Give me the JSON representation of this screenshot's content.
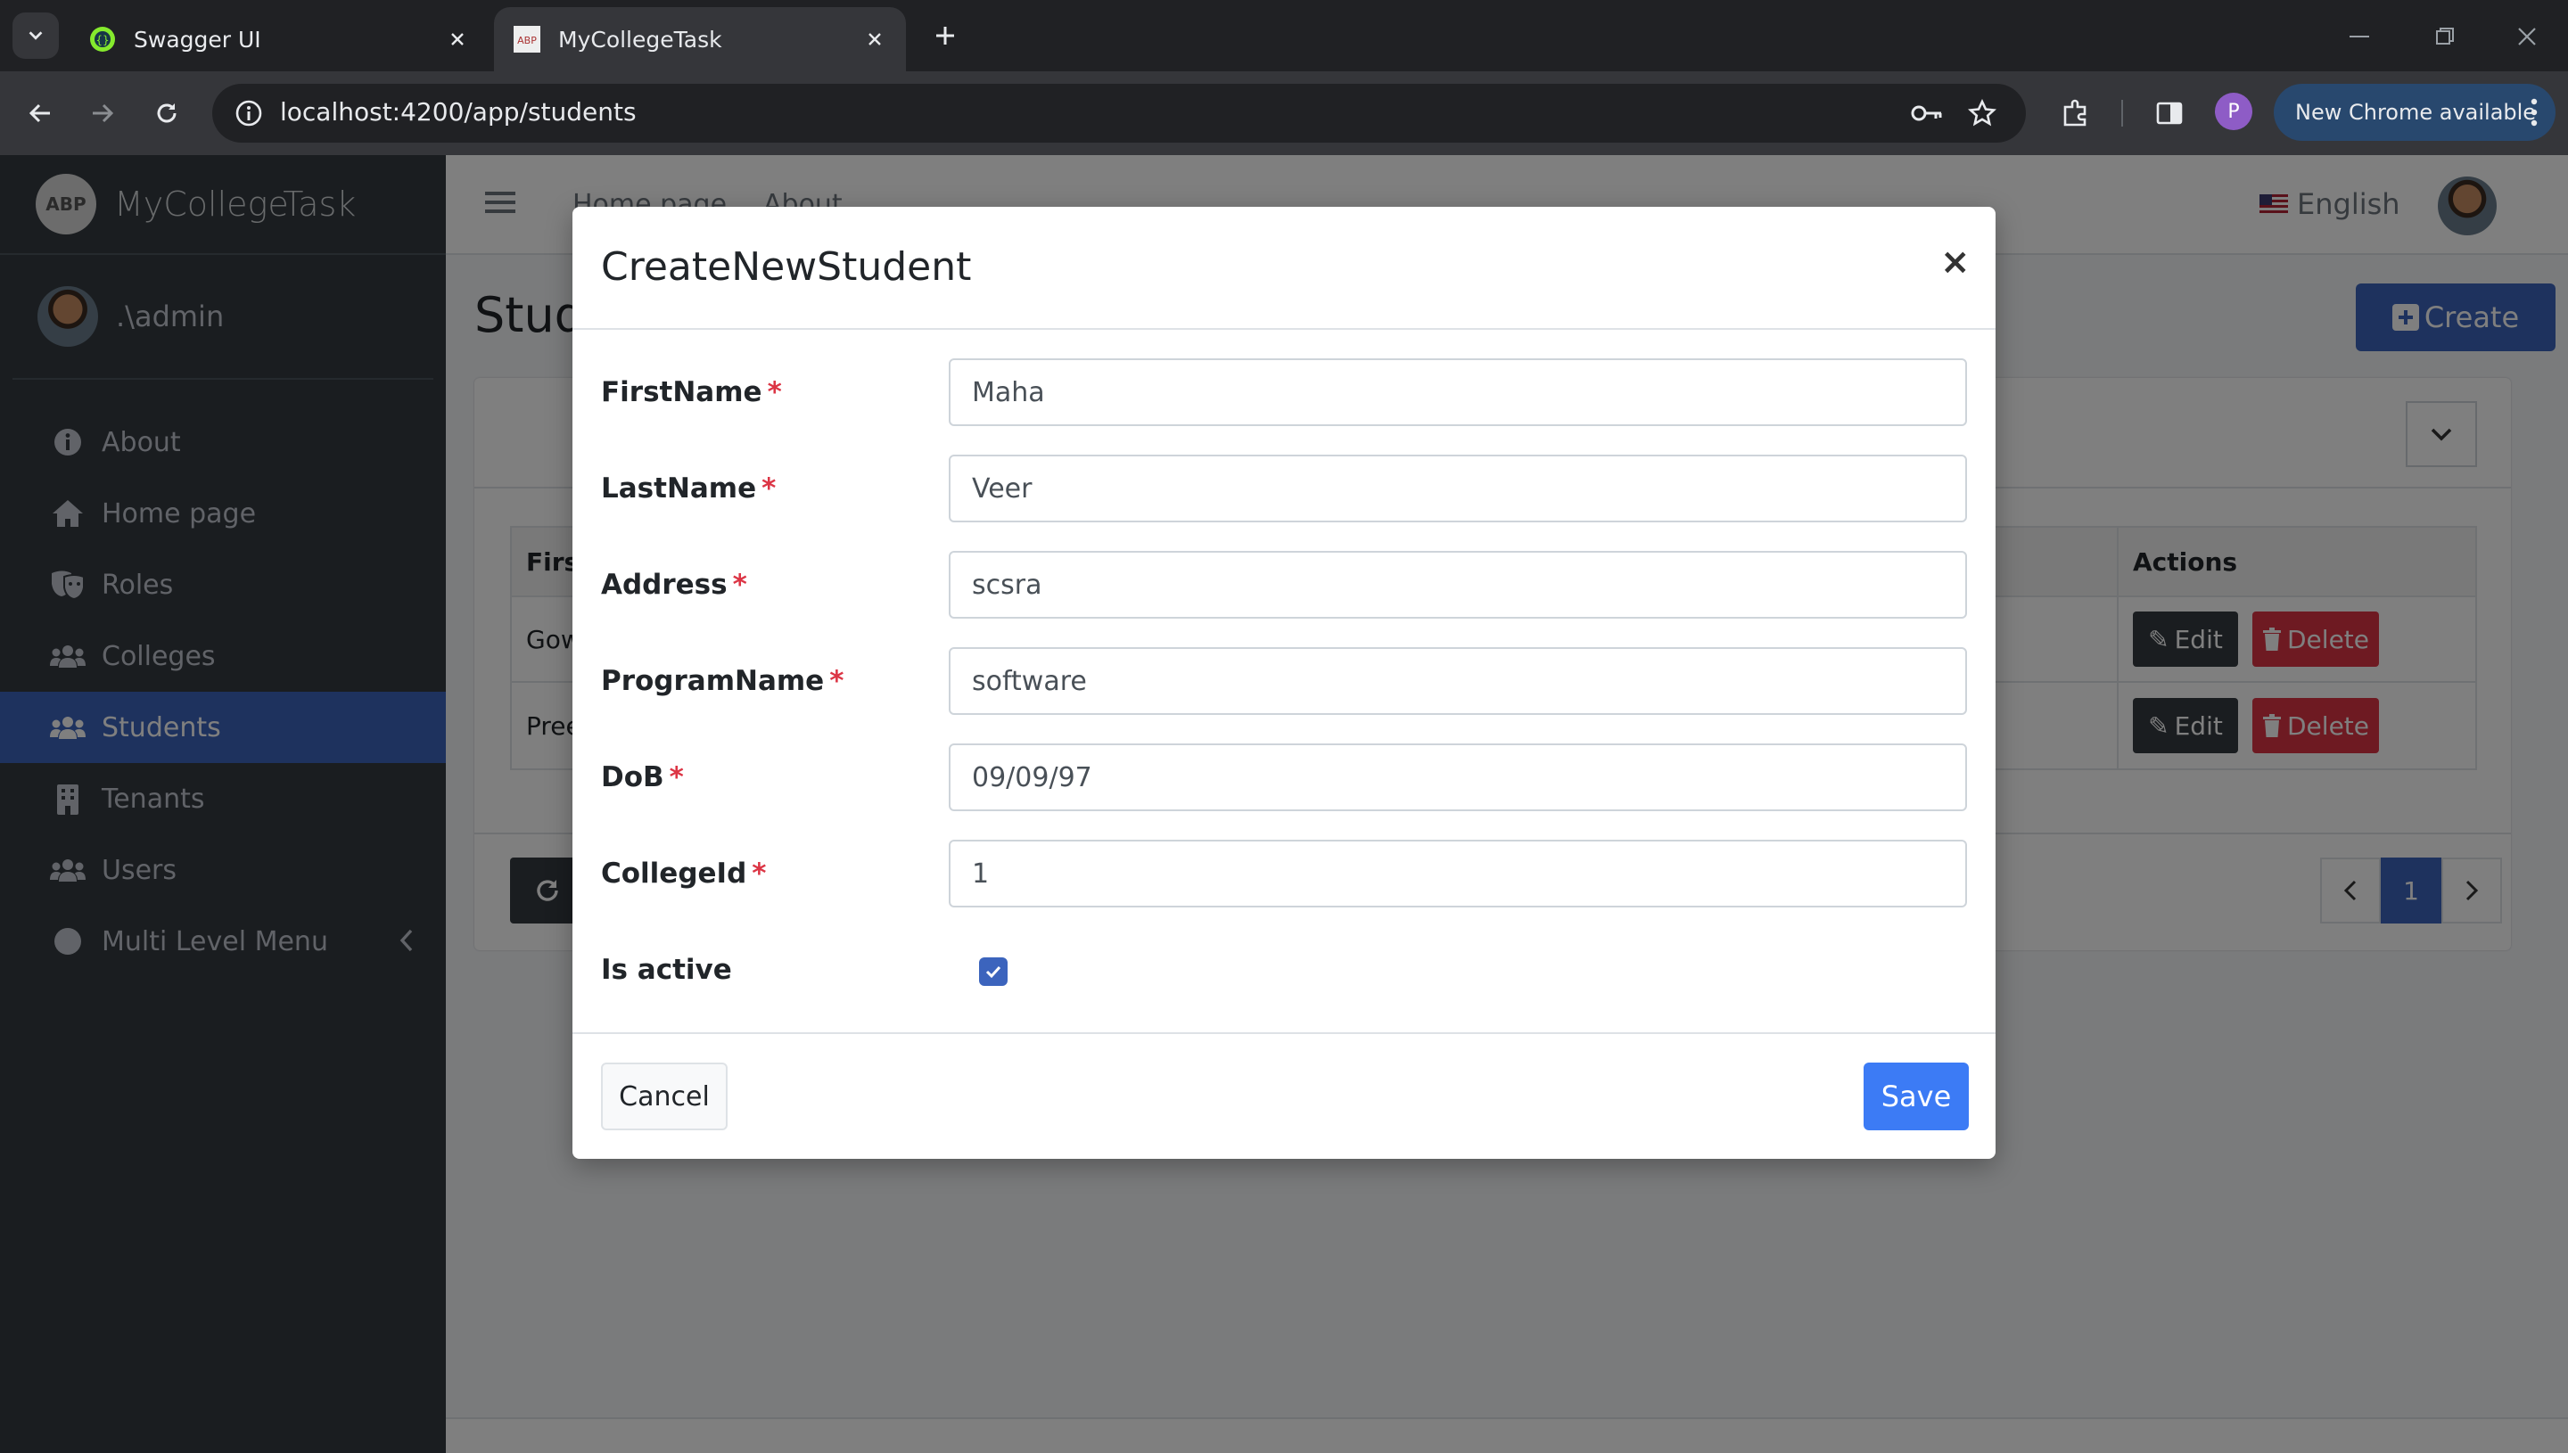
{
  "browser": {
    "tabs": [
      {
        "title": "Swagger UI",
        "active": false
      },
      {
        "title": "MyCollegeTask",
        "active": true
      }
    ],
    "url": "localhost:4200/app/students",
    "update_label": "New Chrome available",
    "profile_initial": "P"
  },
  "app": {
    "brand": "MyCollegeTask",
    "logo_text": "ABP",
    "user": ".\\admin",
    "nav": [
      {
        "label": "About",
        "icon": "info-icon",
        "active": false
      },
      {
        "label": "Home page",
        "icon": "home-icon",
        "active": false
      },
      {
        "label": "Roles",
        "icon": "theater-masks-icon",
        "active": false
      },
      {
        "label": "Colleges",
        "icon": "users-icon",
        "active": false
      },
      {
        "label": "Students",
        "icon": "users-icon",
        "active": true
      },
      {
        "label": "Tenants",
        "icon": "building-icon",
        "active": false
      },
      {
        "label": "Users",
        "icon": "users-icon",
        "active": false
      },
      {
        "label": "Multi Level Menu",
        "icon": "circle-icon",
        "active": false
      }
    ],
    "topnav": {
      "home": "Home page",
      "about": "About",
      "language": "English"
    },
    "page_title": "Students",
    "create_label": "Create",
    "table": {
      "headers": {
        "first": "FirstName",
        "actions": "Actions"
      },
      "rows": [
        {
          "first": "Gowri"
        },
        {
          "first": "Preethi"
        }
      ],
      "edit_label": "Edit",
      "delete_label": "Delete"
    },
    "pager": {
      "current": "1"
    }
  },
  "modal": {
    "title": "CreateNewStudent",
    "close": "×",
    "fields": [
      {
        "label": "FirstName",
        "value": "Maha",
        "required": true
      },
      {
        "label": "LastName",
        "value": "Veer",
        "required": true
      },
      {
        "label": "Address",
        "value": "scsra",
        "required": true
      },
      {
        "label": "ProgramName",
        "value": "software",
        "required": true
      },
      {
        "label": "DoB",
        "value": "09/09/97",
        "required": true
      },
      {
        "label": "CollegeId",
        "value": "1",
        "required": true
      }
    ],
    "is_active": {
      "label": "Is active",
      "checked": true
    },
    "cancel_label": "Cancel",
    "save_label": "Save",
    "required_mark": "*"
  },
  "colors": {
    "primary": "#3c64bd",
    "save": "#3c7bf5",
    "danger": "#dc3545",
    "sidebar": "#343a40"
  }
}
